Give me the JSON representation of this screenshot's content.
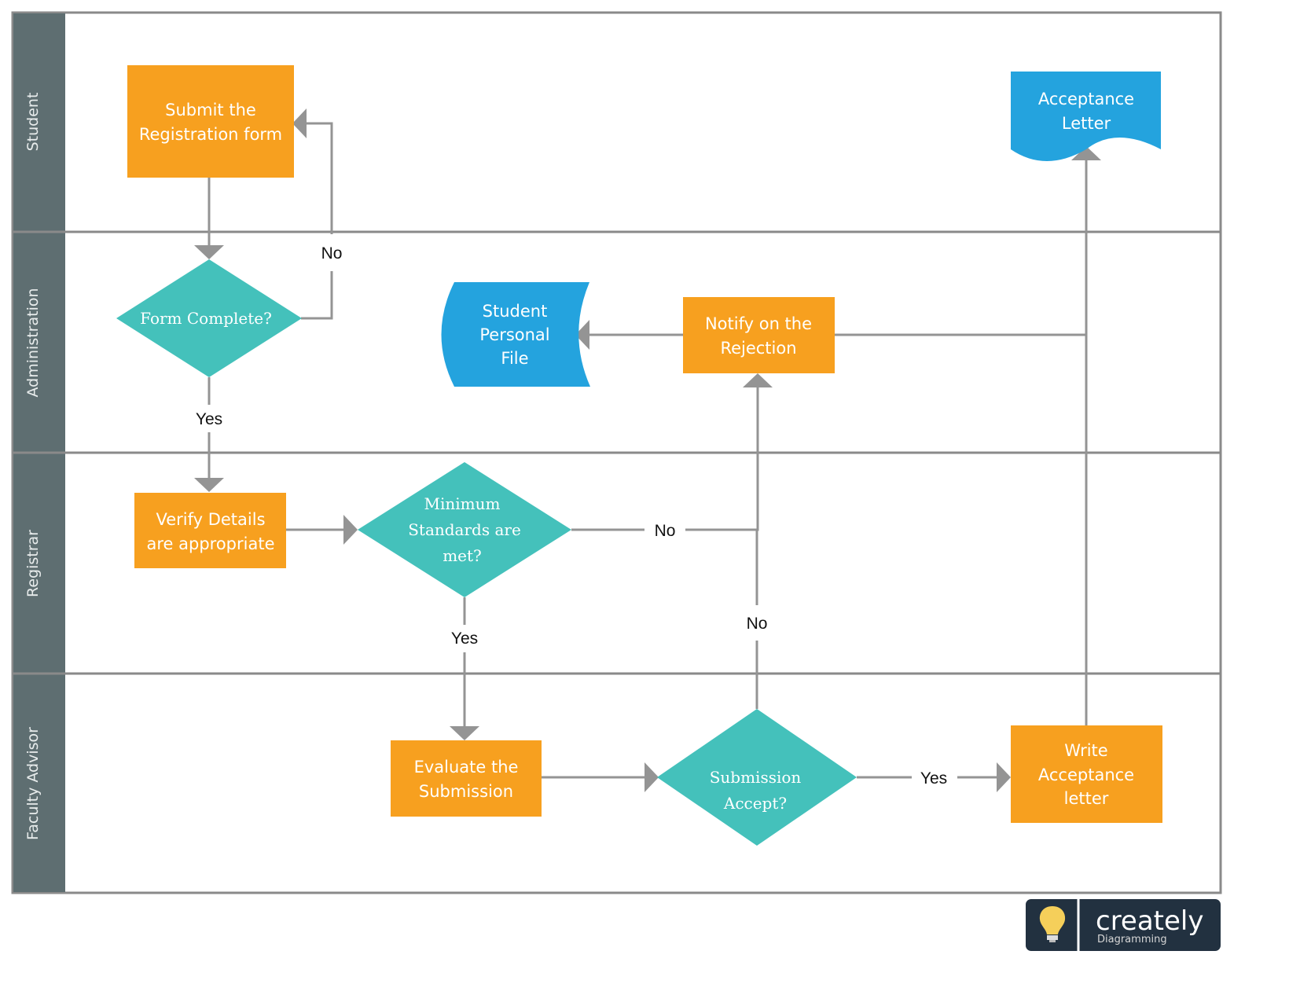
{
  "colors": {
    "process": "#f7a01f",
    "decision": "#44c1bb",
    "data": "#24a3de",
    "lane_header": "#5e6e71",
    "connector": "#949494",
    "border": "#8a8a8a"
  },
  "lanes": [
    {
      "label": "Student"
    },
    {
      "label": "Administration"
    },
    {
      "label": "Registrar"
    },
    {
      "label": "Faculty Advisor"
    }
  ],
  "nodes": {
    "submit_form": {
      "lines": [
        "Submit the",
        "Registration form"
      ]
    },
    "form_complete": {
      "lines": [
        "Form Complete?"
      ]
    },
    "verify_details": {
      "lines": [
        "Verify Details",
        "are appropriate"
      ]
    },
    "minimum_standards": {
      "lines": [
        "Minimum",
        "Standards  are",
        "met?"
      ]
    },
    "evaluate_submission": {
      "lines": [
        "Evaluate the",
        "Submission"
      ]
    },
    "submission_accept": {
      "lines": [
        "Submission",
        "Accept?"
      ]
    },
    "write_acceptance": {
      "lines": [
        "Write",
        "Acceptance",
        "letter"
      ]
    },
    "notify_rejection": {
      "lines": [
        "Notify on the",
        "Rejection"
      ]
    },
    "student_file": {
      "lines": [
        "Student",
        "Personal",
        "File"
      ]
    },
    "acceptance_letter": {
      "lines": [
        "Acceptance",
        "Letter"
      ]
    }
  },
  "edge_labels": {
    "form_no": "No",
    "form_yes": "Yes",
    "standards_no": "No",
    "standards_yes": "Yes",
    "accept_no": "No",
    "accept_yes": "Yes"
  },
  "logo": {
    "brand": "creately",
    "tagline": "Diagramming"
  }
}
